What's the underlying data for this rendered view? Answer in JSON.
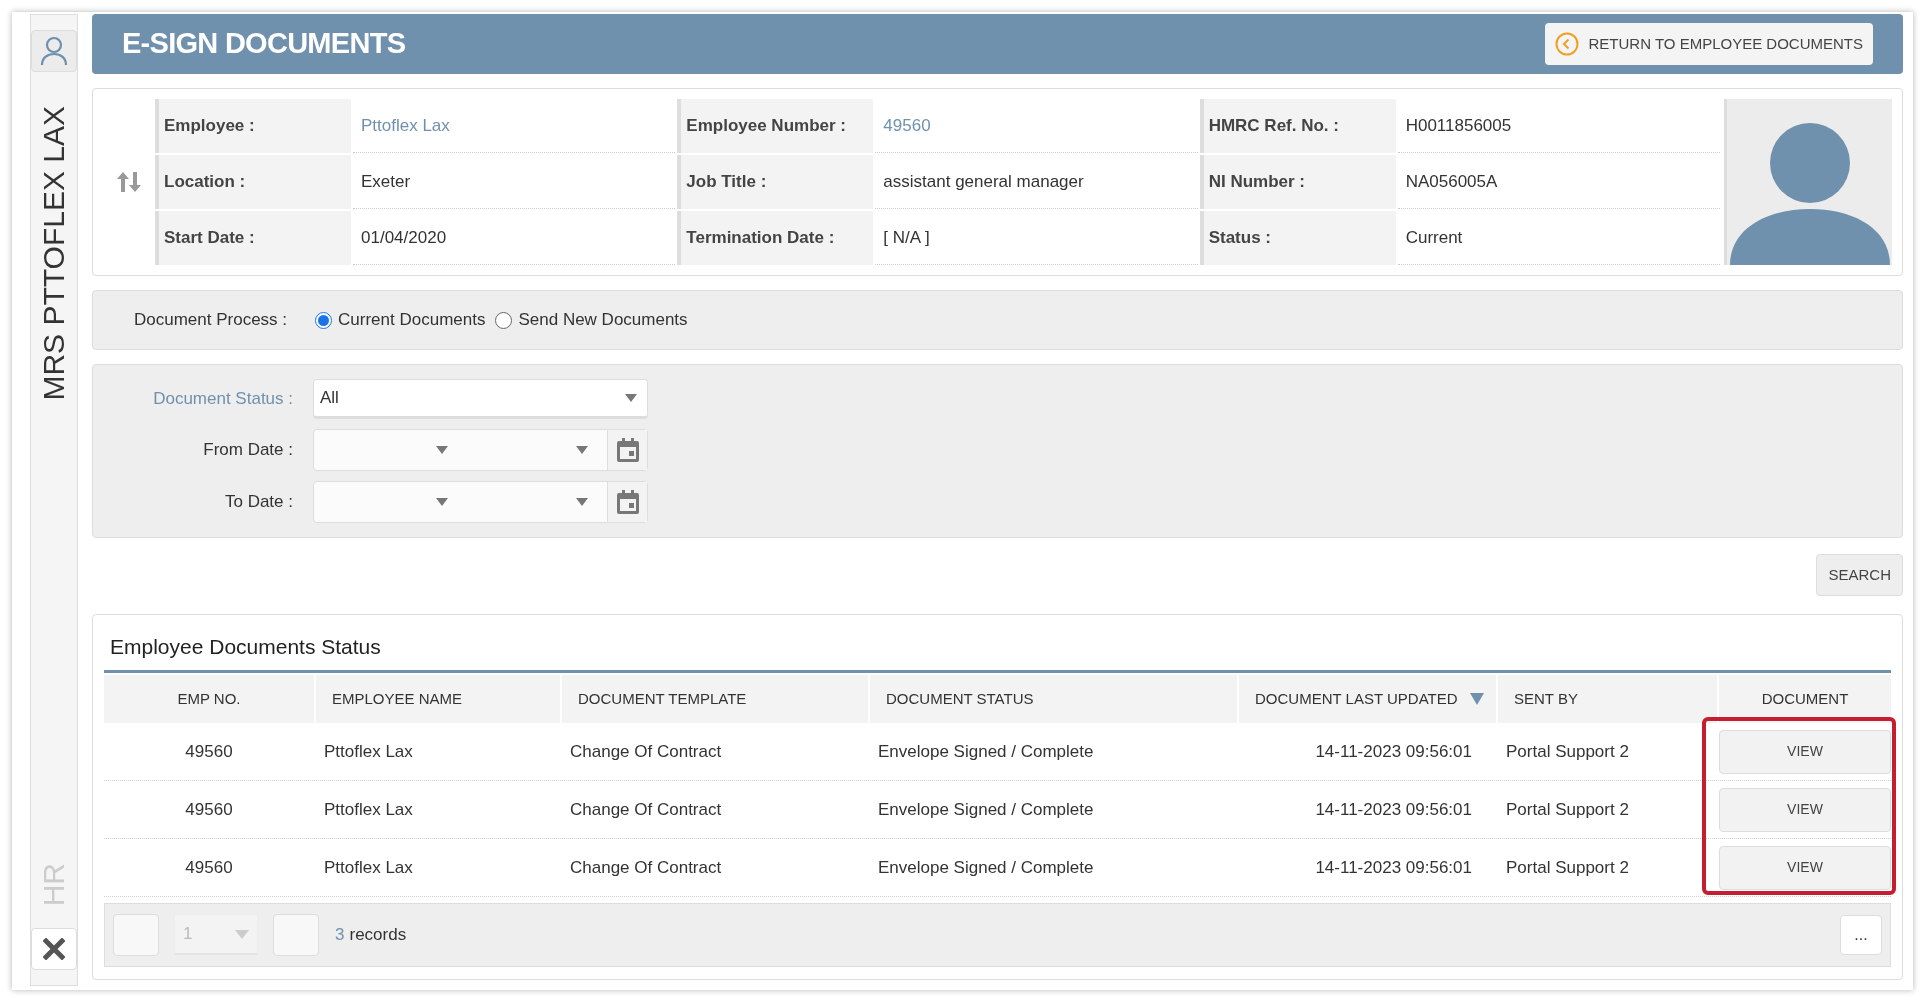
{
  "sidebar": {
    "employee_name": "MRS PTTOFLEX LAX",
    "module": "HR"
  },
  "header": {
    "title": "E-SIGN DOCUMENTS",
    "return_button": "RETURN TO EMPLOYEE DOCUMENTS"
  },
  "employee_info": {
    "fields": [
      {
        "label": "Employee :",
        "value": "Pttoflex Lax",
        "kind": "link"
      },
      {
        "label": "Employee Number :",
        "value": "49560",
        "kind": "link"
      },
      {
        "label": "HMRC Ref. No. :",
        "value": "H0011856005",
        "kind": "text"
      },
      {
        "label": "Location :",
        "value": "Exeter",
        "kind": "text"
      },
      {
        "label": "Job Title :",
        "value": "assistant general manager",
        "kind": "text"
      },
      {
        "label": "NI Number :",
        "value": "NA056005A",
        "kind": "text"
      },
      {
        "label": "Start Date :",
        "value": "01/04/2020",
        "kind": "text"
      },
      {
        "label": "Termination Date :",
        "value": "[ N/A ]",
        "kind": "text"
      },
      {
        "label": "Status :",
        "value": "Current",
        "kind": "text"
      }
    ]
  },
  "document_process": {
    "label": "Document Process :",
    "options": [
      {
        "label": "Current Documents",
        "selected": true
      },
      {
        "label": "Send New Documents",
        "selected": false
      }
    ]
  },
  "filters": {
    "document_status": {
      "label": "Document Status :",
      "value": "All"
    },
    "from_date": {
      "label": "From Date :"
    },
    "to_date": {
      "label": "To Date :"
    }
  },
  "search_button": "SEARCH",
  "table": {
    "title": "Employee Documents Status",
    "highlight_actions": true,
    "columns": [
      {
        "label": "EMP NO.",
        "sorted_descending": false
      },
      {
        "label": "EMPLOYEE NAME",
        "sorted_descending": false
      },
      {
        "label": "DOCUMENT TEMPLATE",
        "sorted_descending": false
      },
      {
        "label": "DOCUMENT STATUS",
        "sorted_descending": false
      },
      {
        "label": "DOCUMENT LAST UPDATED",
        "sorted_descending": true
      },
      {
        "label": "SENT BY",
        "sorted_descending": false
      },
      {
        "label": "DOCUMENT",
        "sorted_descending": false
      }
    ],
    "rows": [
      {
        "cells": [
          "49560",
          "Pttoflex Lax",
          "Change Of Contract",
          "Envelope Signed / Complete",
          "14-11-2023 09:56:01",
          "Portal Support 2"
        ],
        "action": "VIEW"
      },
      {
        "cells": [
          "49560",
          "Pttoflex Lax",
          "Change Of Contract",
          "Envelope Signed / Complete",
          "14-11-2023 09:56:01",
          "Portal Support 2"
        ],
        "action": "VIEW"
      },
      {
        "cells": [
          "49560",
          "Pttoflex Lax",
          "Change Of Contract",
          "Envelope Signed / Complete",
          "14-11-2023 09:56:01",
          "Portal Support 2"
        ],
        "action": "VIEW"
      }
    ]
  },
  "pager": {
    "page": "1",
    "count": "3",
    "records_label": "records",
    "more_button": "..."
  }
}
